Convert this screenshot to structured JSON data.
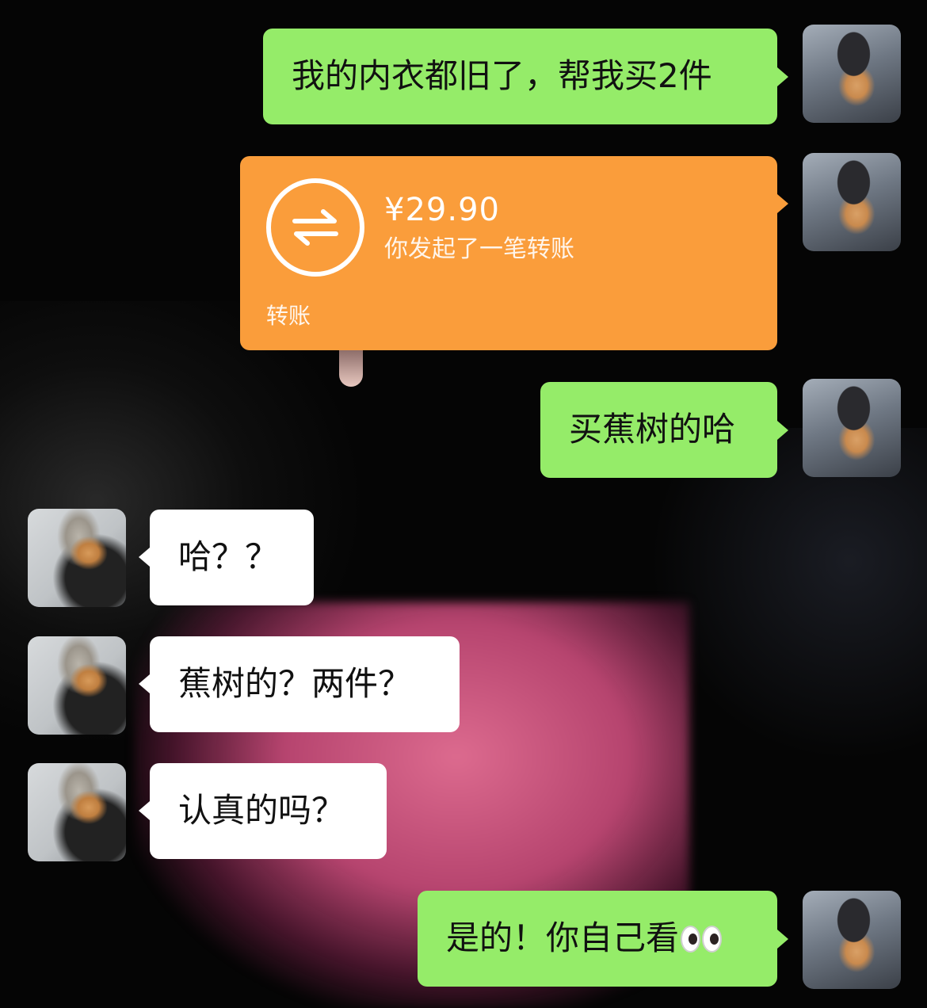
{
  "messages": [
    {
      "sender": "me",
      "type": "text",
      "text": "我的内衣都旧了，帮我买2件"
    },
    {
      "sender": "me",
      "type": "transfer",
      "amount": "¥29.90",
      "subtitle": "你发起了一笔转账",
      "footer": "转账",
      "icon": "transfer-arrows-icon",
      "color": "#fa9d3b"
    },
    {
      "sender": "me",
      "type": "text",
      "text": "买蕉树的哈"
    },
    {
      "sender": "them",
      "type": "text",
      "text": "哈？？"
    },
    {
      "sender": "them",
      "type": "text",
      "text": "蕉树的？两件？"
    },
    {
      "sender": "them",
      "type": "text",
      "text": "认真的吗？"
    },
    {
      "sender": "me",
      "type": "text",
      "text": "是的！你自己看",
      "emoji": "eyes-emoji"
    }
  ],
  "colors": {
    "outgoing_bubble": "#95ec69",
    "incoming_bubble": "#ffffff",
    "transfer_card": "#fa9d3b",
    "background": "#050505"
  }
}
